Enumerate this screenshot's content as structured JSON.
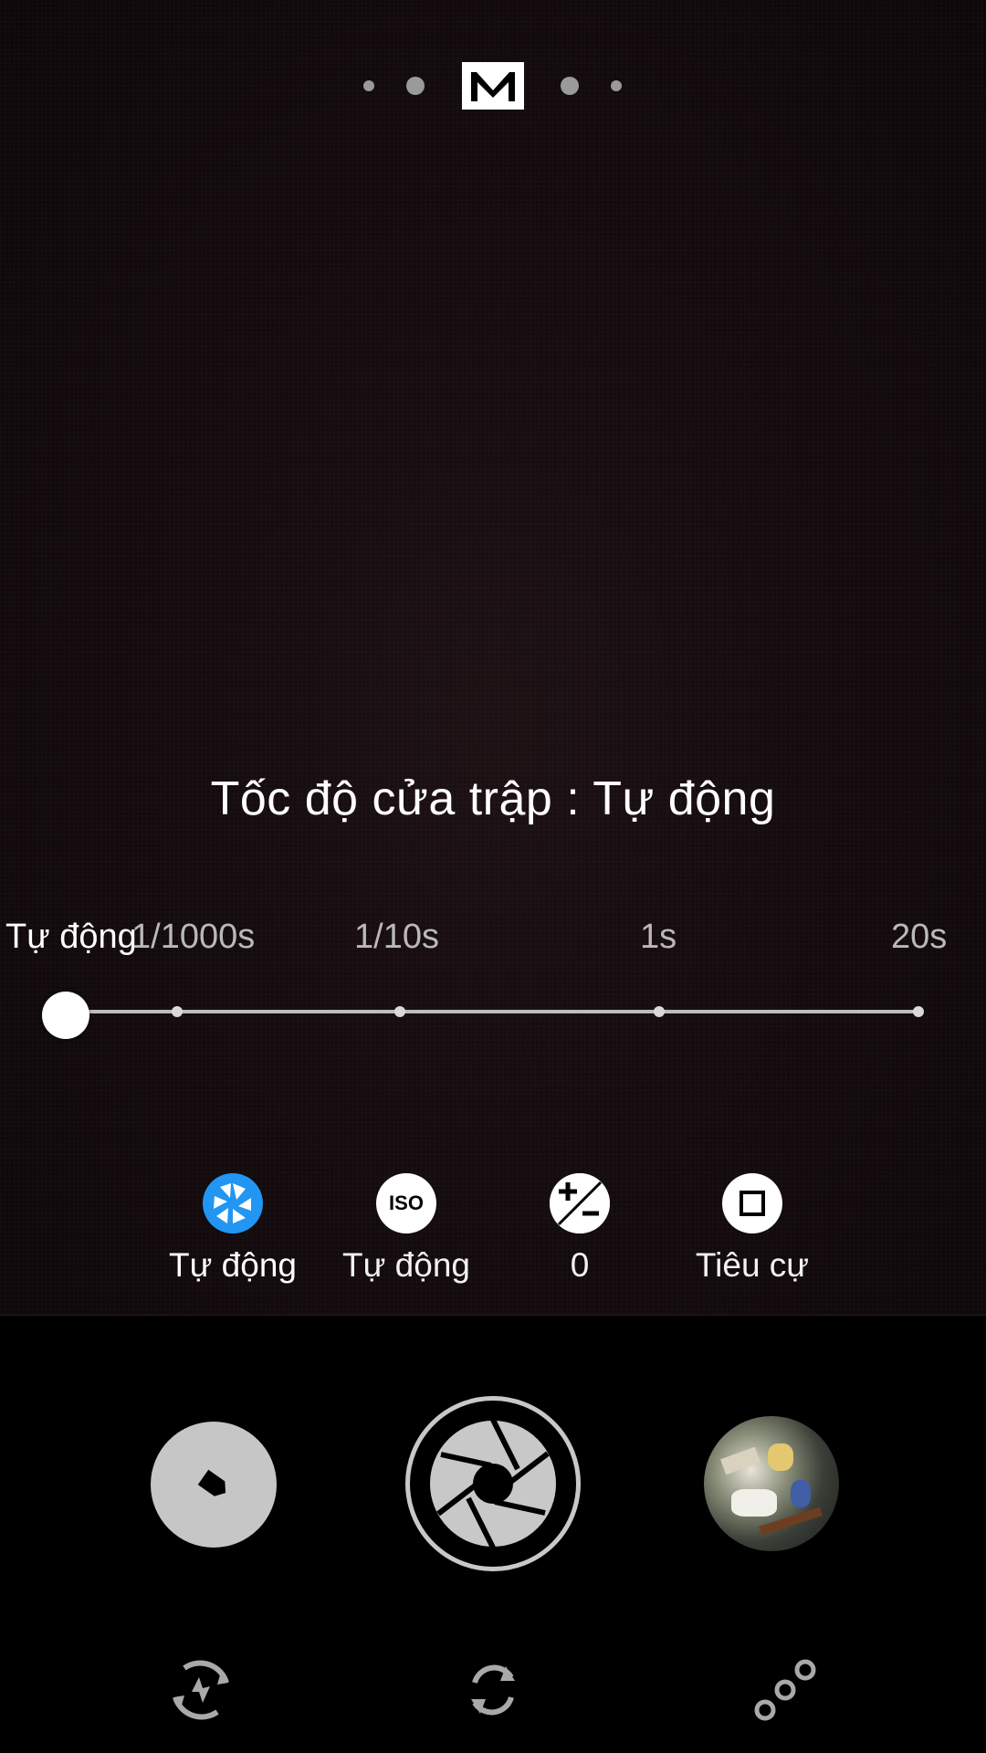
{
  "mode": {
    "current_label": "M",
    "indicator_dots": 4
  },
  "setting": {
    "title": "Tốc độ cửa trập : Tự động"
  },
  "shutter_scale": {
    "labels": [
      "Tự động",
      "1/1000s",
      "1/10s",
      "1s",
      "20s"
    ],
    "selected_label": "Tự động",
    "selected_index": 0
  },
  "controls": [
    {
      "name": "shutter-speed",
      "icon": "aperture-icon",
      "label": "Tự động",
      "active": true
    },
    {
      "name": "iso",
      "icon": "iso-icon",
      "icon_text": "ISO",
      "label": "Tự động",
      "active": false
    },
    {
      "name": "exposure",
      "icon": "exposure-compensation-icon",
      "label": "0",
      "active": false
    },
    {
      "name": "focus",
      "icon": "focus-square-icon",
      "label": "Tiêu cự",
      "active": false
    }
  ],
  "bottom": {
    "left_button_icon": "video-tag-icon",
    "shutter_icon": "shutter-aperture-icon",
    "gallery_thumbnail": "gallery-thumbnail",
    "tools": [
      "flash-auto-icon",
      "switch-camera-icon",
      "more-modes-icon"
    ]
  },
  "colors": {
    "accent": "#2196F3",
    "icon_bg": "#ffffff",
    "shutter_gray": "#c8c8c8"
  }
}
